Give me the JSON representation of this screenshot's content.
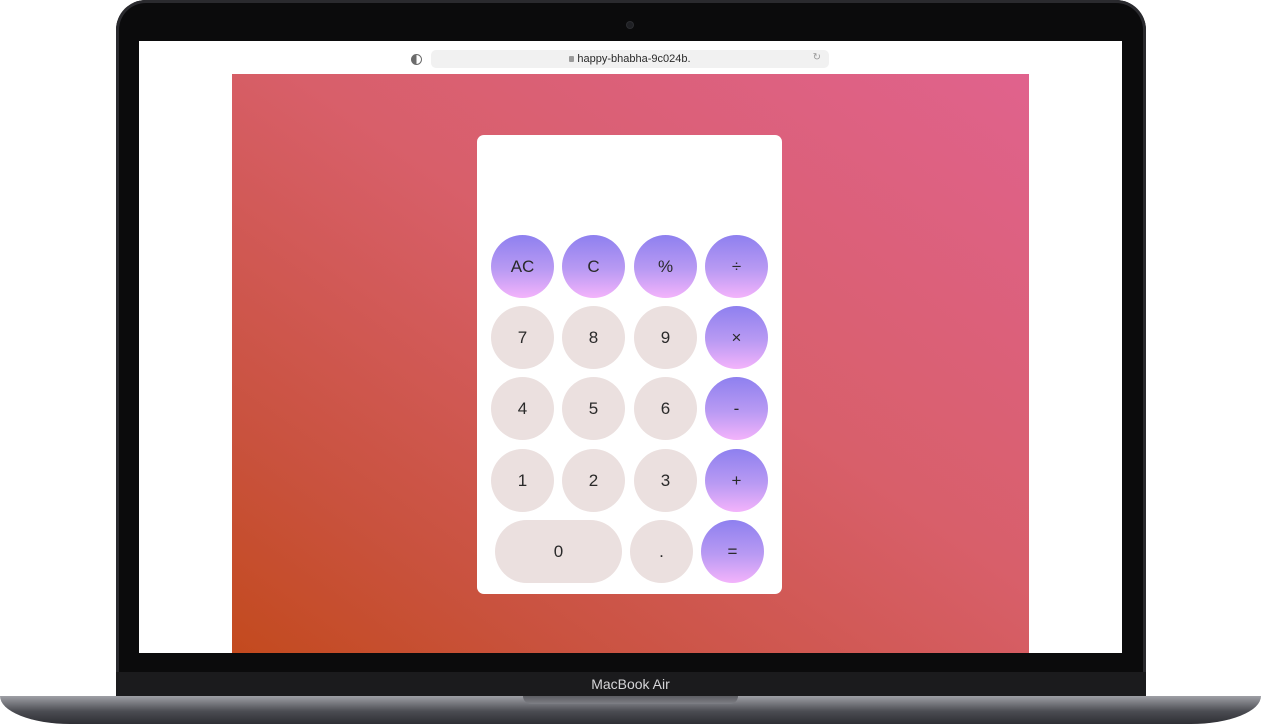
{
  "browser": {
    "url": "happy-bhabha-9c024b."
  },
  "calculator": {
    "display": "",
    "keys": {
      "ac": "AC",
      "c": "C",
      "percent": "%",
      "divide": "÷",
      "seven": "7",
      "eight": "8",
      "nine": "9",
      "multiply": "×",
      "four": "4",
      "five": "5",
      "six": "6",
      "minus": "-",
      "one": "1",
      "two": "2",
      "three": "3",
      "plus": "+",
      "zero": "0",
      "dot": ".",
      "equals": "="
    }
  },
  "device": {
    "model": "MacBook Air"
  },
  "colors": {
    "page_gradient_top_right": "#e0628d",
    "page_gradient_bottom_left": "#c34a1e",
    "number_key": "#ebe0df",
    "operator_key_top": "#8e80ef",
    "operator_key_bottom": "#f3b3fb"
  }
}
